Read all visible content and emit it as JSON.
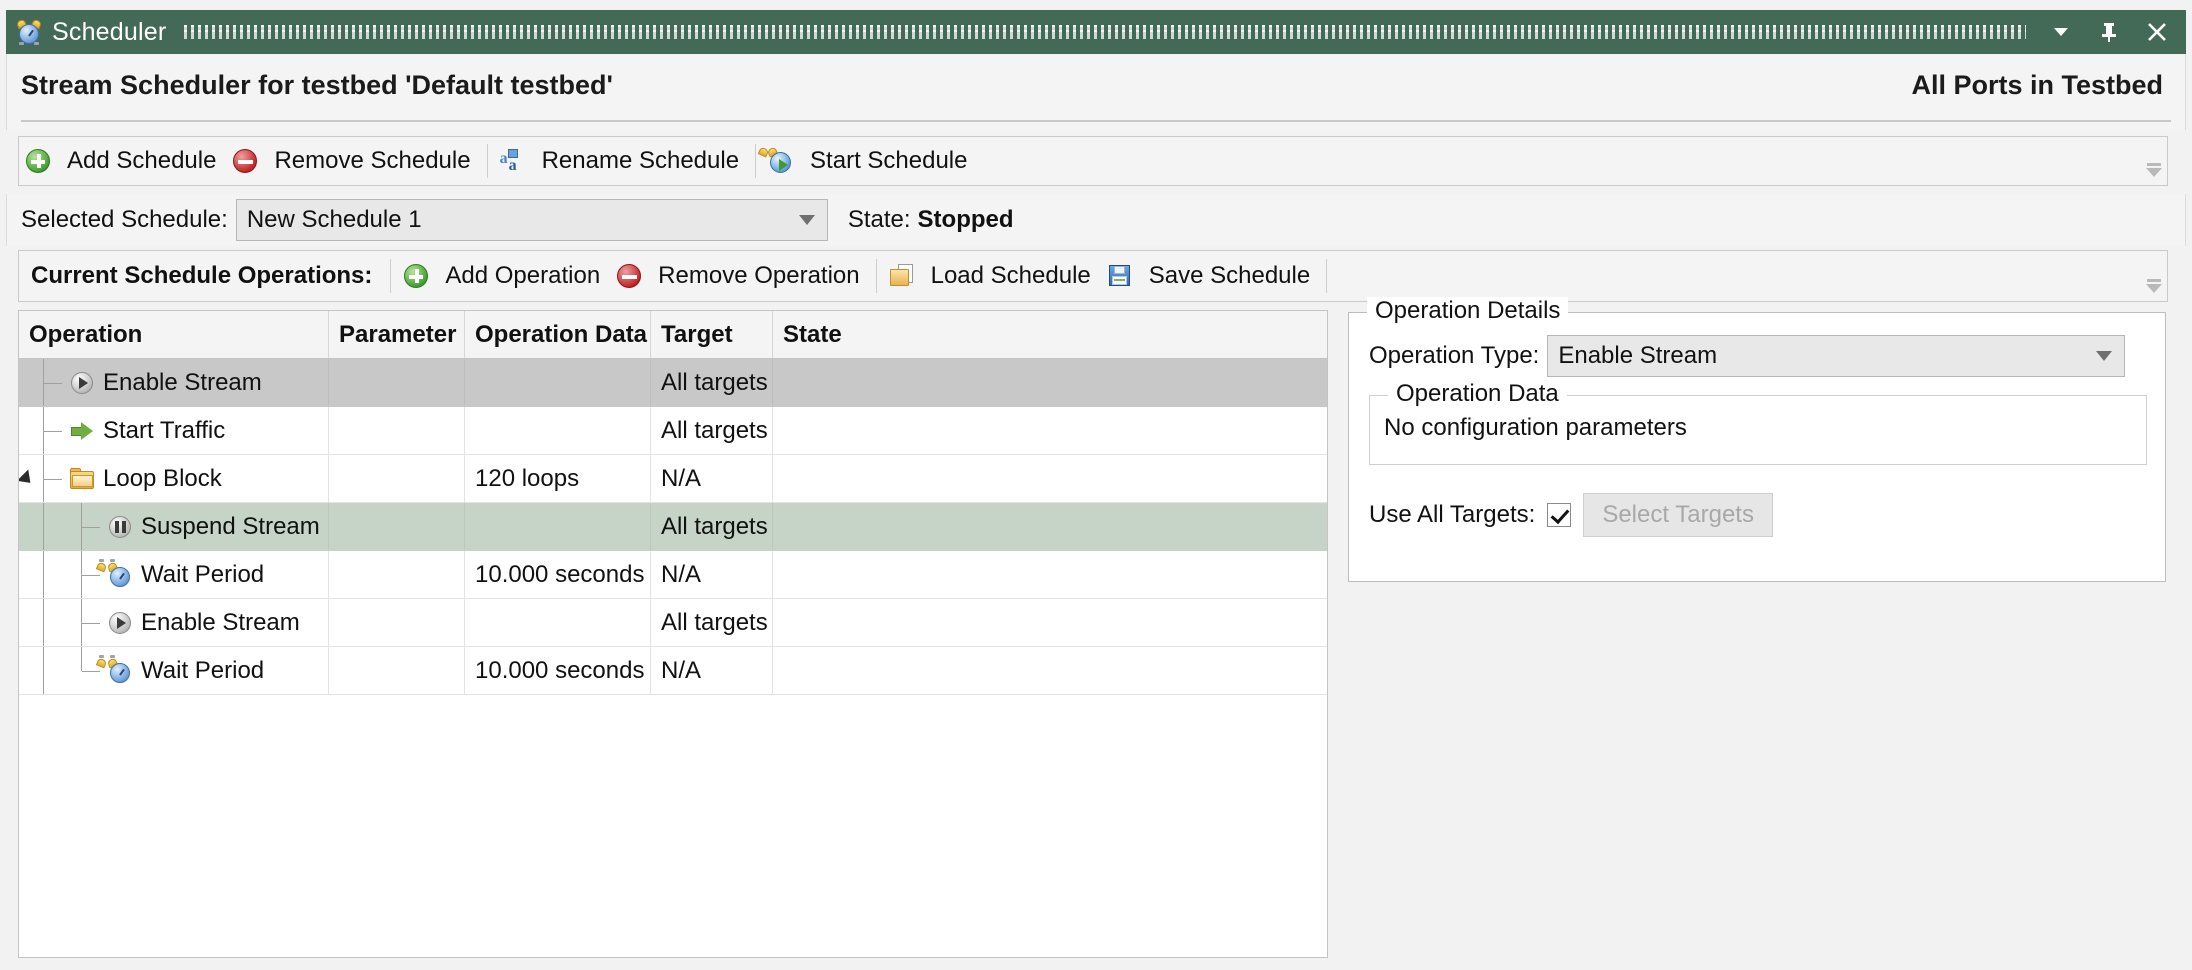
{
  "window": {
    "title": "Scheduler",
    "icon": "alarm-clock-icon",
    "accent_color": "#436a56",
    "buttons": [
      {
        "name": "minimize-dropdown",
        "glyph": "▼"
      },
      {
        "name": "pin",
        "glyph": "pin-icon"
      },
      {
        "name": "close",
        "glyph": "✕"
      }
    ]
  },
  "header": {
    "title": "Stream Scheduler for testbed 'Default testbed'",
    "right_label": "All Ports in Testbed"
  },
  "schedule_toolbar": {
    "buttons": [
      {
        "label": "Add Schedule",
        "icon": "add-circle-icon"
      },
      {
        "label": "Remove Schedule",
        "icon": "remove-circle-icon"
      },
      {
        "label": "Rename Schedule",
        "icon": "rename-icon"
      },
      {
        "label": "Start Schedule",
        "icon": "start-clock-icon"
      }
    ]
  },
  "schedule_select": {
    "label": "Selected Schedule:",
    "value": "New Schedule 1",
    "state_label": "State:",
    "state_value": "Stopped"
  },
  "operations_toolbar": {
    "label": "Current Schedule Operations:",
    "buttons": [
      {
        "label": "Add Operation",
        "icon": "add-circle-icon"
      },
      {
        "label": "Remove Operation",
        "icon": "remove-circle-icon"
      },
      {
        "label": "Load Schedule",
        "icon": "load-folder-icon"
      },
      {
        "label": "Save Schedule",
        "icon": "save-disk-icon"
      }
    ]
  },
  "table": {
    "columns": [
      "Operation",
      "Parameter",
      "Operation Data",
      "Target",
      "State"
    ],
    "rows": [
      {
        "operation": "Enable Stream",
        "parameter": "",
        "operation_data": "",
        "target": "All targets",
        "state": "",
        "icon": "play-circle-icon",
        "depth": 1,
        "selected": "grey",
        "expander": false
      },
      {
        "operation": "Start Traffic",
        "parameter": "",
        "operation_data": "",
        "target": "All targets",
        "state": "",
        "icon": "green-arrow-icon",
        "depth": 1,
        "selected": "none",
        "expander": false
      },
      {
        "operation": "Loop Block",
        "parameter": "",
        "operation_data": "120 loops",
        "target": "N/A",
        "state": "",
        "icon": "folder-icon",
        "depth": 1,
        "selected": "none",
        "expander": true
      },
      {
        "operation": "Suspend Stream",
        "parameter": "",
        "operation_data": "",
        "target": "All targets",
        "state": "",
        "icon": "pause-circle-icon",
        "depth": 2,
        "selected": "green",
        "expander": false
      },
      {
        "operation": "Wait Period",
        "parameter": "",
        "operation_data": "10.000 seconds",
        "target": "N/A",
        "state": "",
        "icon": "alarm-clock-icon",
        "depth": 2,
        "selected": "none",
        "expander": false
      },
      {
        "operation": "Enable Stream",
        "parameter": "",
        "operation_data": "",
        "target": "All targets",
        "state": "",
        "icon": "play-circle-icon",
        "depth": 2,
        "selected": "none",
        "expander": false
      },
      {
        "operation": "Wait Period",
        "parameter": "",
        "operation_data": "10.000 seconds",
        "target": "N/A",
        "state": "",
        "icon": "alarm-clock-icon",
        "depth": 2,
        "selected": "none",
        "expander": false
      }
    ]
  },
  "details": {
    "legend": "Operation Details",
    "operation_type_label": "Operation Type:",
    "operation_type_value": "Enable Stream",
    "operation_data_legend": "Operation Data",
    "operation_data_text": "No configuration parameters",
    "use_all_targets_label": "Use All Targets:",
    "use_all_targets_checked": true,
    "select_targets_label": "Select Targets"
  }
}
